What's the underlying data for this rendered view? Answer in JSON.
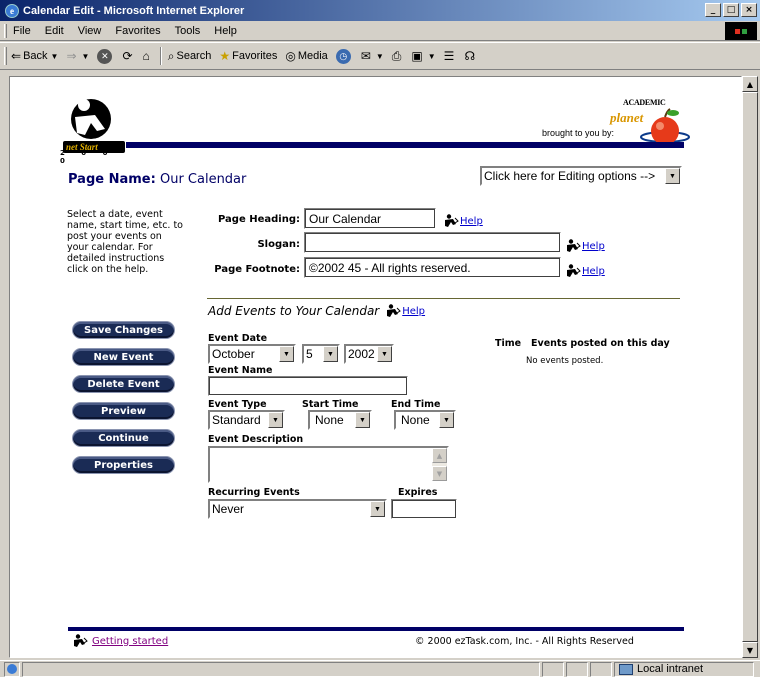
{
  "window": {
    "title": "Calendar Edit - Microsoft Internet Explorer",
    "controls": [
      "_",
      "□",
      "×"
    ]
  },
  "menu": [
    "File",
    "Edit",
    "View",
    "Favorites",
    "Tools",
    "Help"
  ],
  "toolbar": {
    "back": "Back",
    "search": "Search",
    "favorites": "Favorites",
    "media": "Media"
  },
  "page": {
    "logo_year": "2 0 0 0",
    "logo_text": "net Start",
    "brought_by": "brought to you by:",
    "academic_line1": "ACADEMIC",
    "academic_line2": "planet",
    "page_name_label": "Page Name:",
    "page_name_value": "Our Calendar",
    "editing_options": "Click here for Editing options -->",
    "instructions": "Select a date, event name, start time, etc. to post your events on your calendar.  For detailed instructions click on the help.",
    "help_label": "Help",
    "fields": {
      "page_heading_label": "Page Heading:",
      "page_heading_value": "Our Calendar",
      "slogan_label": "Slogan:",
      "slogan_value": "",
      "footnote_label": "Page Footnote:",
      "footnote_value": "©2002 45 - All rights reserved."
    },
    "add_events_title": "Add Events to Your Calendar",
    "nav_buttons": [
      "Save Changes",
      "New Event",
      "Delete Event",
      "Preview",
      "Continue",
      "Properties"
    ],
    "event": {
      "date_label": "Event Date",
      "month": "October",
      "day": "5",
      "year": "2002",
      "name_label": "Event Name",
      "name_value": "",
      "type_label": "Event Type",
      "type_value": "Standard",
      "start_label": "Start Time",
      "start_value": "None",
      "end_label": "End Time",
      "end_value": "None",
      "description_label": "Event Description",
      "recurring_label": "Recurring Events",
      "recurring_value": "Never",
      "expires_label": "Expires",
      "expires_value": ""
    },
    "posted": {
      "time_header": "Time",
      "events_header": "Events posted on this day",
      "empty_text": "No events posted."
    },
    "footer": {
      "getting_started": "Getting started",
      "copyright": "© 2000 ezTask.com, Inc. - All Rights Reserved"
    }
  },
  "status": {
    "zone": "Local intranet"
  },
  "colors": {
    "navy": "#000066",
    "button": "#1a2b55",
    "link": "#0000cc",
    "visited": "#800080"
  }
}
